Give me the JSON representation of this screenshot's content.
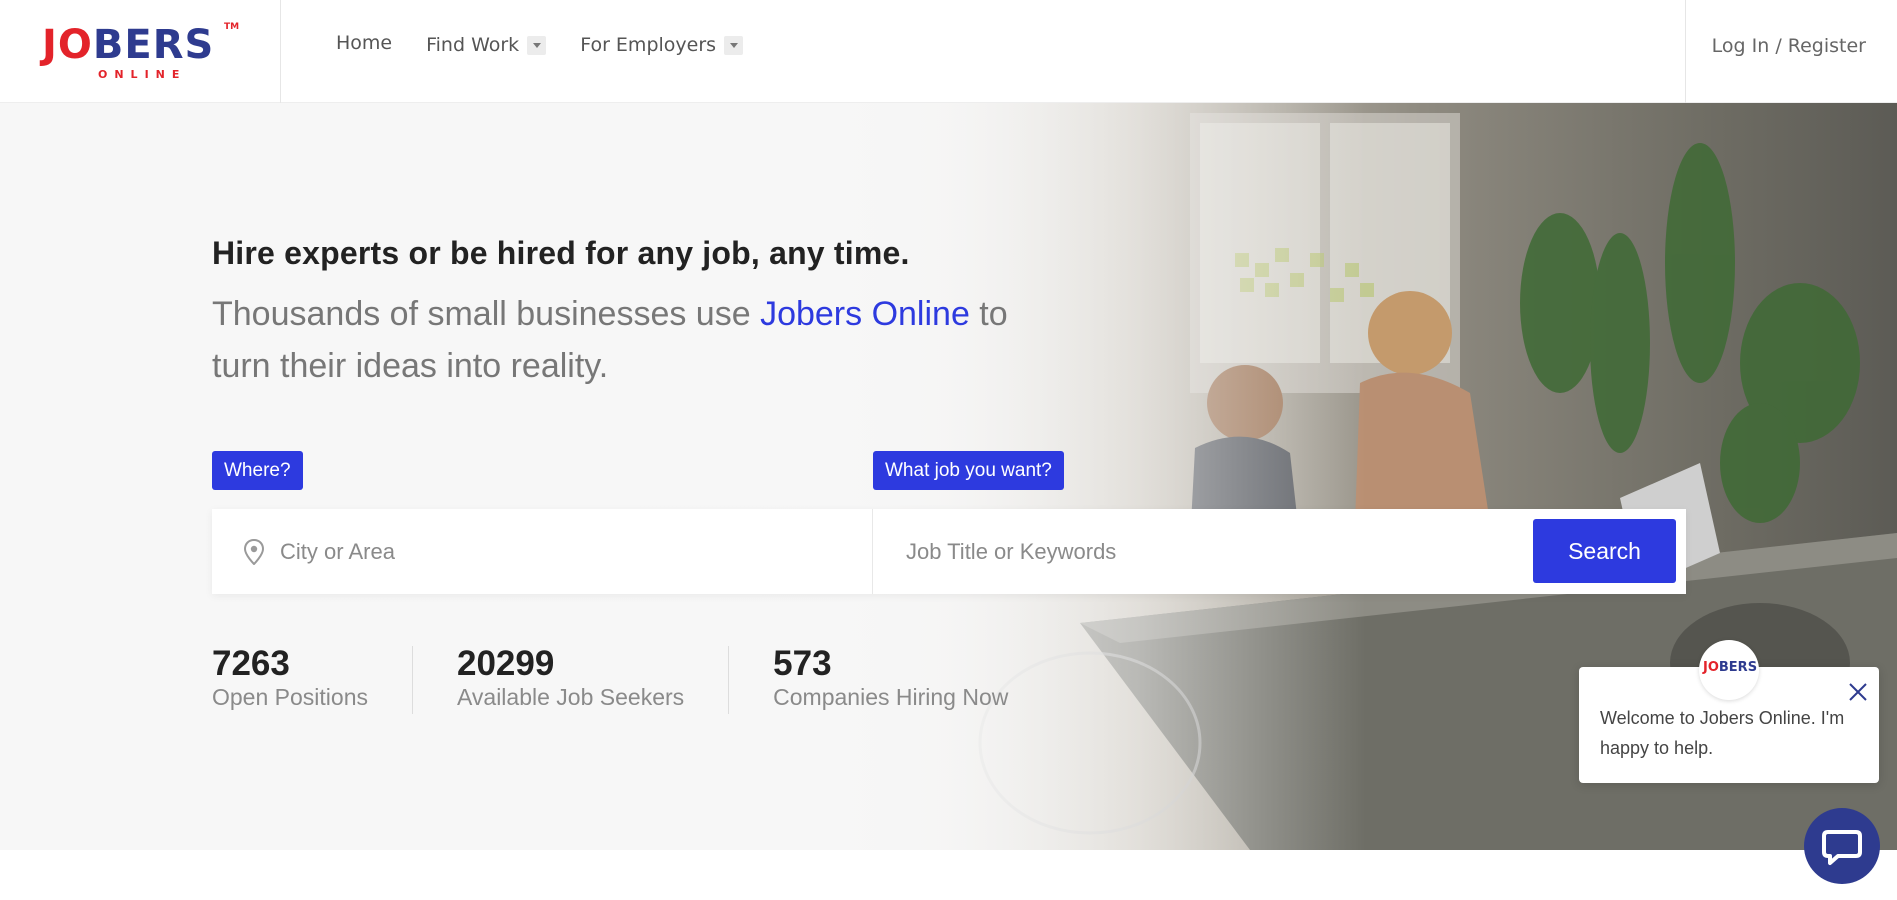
{
  "logo": {
    "word_j": "J",
    "word_o": "O",
    "word_rest": "BERS",
    "tm": "TM",
    "sub": "ONLINE"
  },
  "nav": {
    "home": "Home",
    "find_work": "Find Work",
    "for_employers": "For Employers"
  },
  "header": {
    "login": "Log In / Register"
  },
  "hero": {
    "headline": "Hire experts or be hired for any job, any time.",
    "sub_prefix": "Thousands of small businesses use ",
    "sub_brand": "Jobers Online",
    "sub_suffix": " to turn their ideas into reality."
  },
  "search": {
    "where_label": "Where?",
    "what_label": "What job you want?",
    "city_placeholder": "City or Area",
    "job_placeholder": "Job Title or Keywords",
    "button": "Search"
  },
  "stats": [
    {
      "number": "7263",
      "label": "Open Positions"
    },
    {
      "number": "20299",
      "label": "Available Job Seekers"
    },
    {
      "number": "573",
      "label": "Companies Hiring Now"
    }
  ],
  "chat": {
    "message": "Welcome to Jobers Online. I'm happy to help.",
    "avatar_text_red": "JO",
    "avatar_text_blue": "BERS"
  },
  "colors": {
    "accent": "#2d3adf",
    "brand_red": "#e3232a",
    "brand_navy": "#2e3b8f"
  }
}
